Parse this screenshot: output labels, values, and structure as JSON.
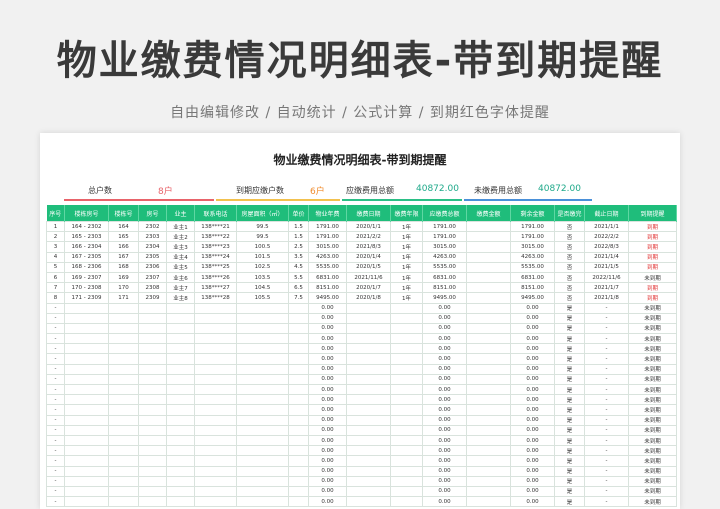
{
  "banner": {
    "title": "物业缴费情况明细表-带到期提醒",
    "subtitle": "自由编辑修改  /  自动统计  /  公式计算  /  到期红色字体提醒"
  },
  "sheet": {
    "title": "物业缴费情况明细表-带到期提醒",
    "stats": {
      "total_households_label": "总户数",
      "total_households_value": "8户",
      "due_households_label": "到期应缴户数",
      "due_households_value": "6户",
      "due_amount_label": "应缴费用总额",
      "due_amount_value": "40872.00",
      "unpaid_amount_label": "未缴费用总额",
      "unpaid_amount_value": "40872.00"
    },
    "colors": {
      "header_green": "#1fbd7b",
      "overdue_red": "#e03030",
      "stat_bar_red": "#e8636a",
      "stat_bar_yellow": "#f2c14e",
      "stat_bar_green": "#2bbf86",
      "stat_bar_blue": "#4a90d9",
      "value_orange": "#f08c2e",
      "value_teal": "#1fa98a"
    },
    "columns": [
      "序号",
      "楼栋房号",
      "楼栋号",
      "房号",
      "业主",
      "联系电话",
      "房屋面积（㎡）",
      "单价",
      "物业年费",
      "缴费日期",
      "缴费年限",
      "应缴费总额",
      "缴费金额",
      "剩余金额",
      "是否缴完",
      "截止日期",
      "到期提醒"
    ],
    "rows": [
      [
        "1",
        "164 - 2302",
        "164",
        "2302",
        "业主1",
        "138****21",
        "99.5",
        "1.5",
        "1791.00",
        "2020/1/1",
        "1年",
        "1791.00",
        "",
        "1791.00",
        "否",
        "2021/1/1",
        "到期"
      ],
      [
        "2",
        "165 - 2303",
        "165",
        "2303",
        "业主2",
        "138****22",
        "99.5",
        "1.5",
        "1791.00",
        "2021/2/2",
        "1年",
        "1791.00",
        "",
        "1791.00",
        "否",
        "2022/2/2",
        "到期"
      ],
      [
        "3",
        "166 - 2304",
        "166",
        "2304",
        "业主3",
        "138****23",
        "100.5",
        "2.5",
        "3015.00",
        "2021/8/3",
        "1年",
        "3015.00",
        "",
        "3015.00",
        "否",
        "2022/8/3",
        "到期"
      ],
      [
        "4",
        "167 - 2305",
        "167",
        "2305",
        "业主4",
        "138****24",
        "101.5",
        "3.5",
        "4263.00",
        "2020/1/4",
        "1年",
        "4263.00",
        "",
        "4263.00",
        "否",
        "2021/1/4",
        "到期"
      ],
      [
        "5",
        "168 - 2306",
        "168",
        "2306",
        "业主5",
        "138****25",
        "102.5",
        "4.5",
        "5535.00",
        "2020/1/5",
        "1年",
        "5535.00",
        "",
        "5535.00",
        "否",
        "2021/1/5",
        "到期"
      ],
      [
        "6",
        "169 - 2307",
        "169",
        "2307",
        "业主6",
        "138****26",
        "103.5",
        "5.5",
        "6831.00",
        "2021/11/6",
        "1年",
        "6831.00",
        "",
        "6831.00",
        "否",
        "2022/11/6",
        "未到期"
      ],
      [
        "7",
        "170 - 2308",
        "170",
        "2308",
        "业主7",
        "138****27",
        "104.5",
        "6.5",
        "8151.00",
        "2020/1/7",
        "1年",
        "8151.00",
        "",
        "8151.00",
        "否",
        "2021/1/7",
        "到期"
      ],
      [
        "8",
        "171 - 2309",
        "171",
        "2309",
        "业主8",
        "138****28",
        "105.5",
        "7.5",
        "9495.00",
        "2020/1/8",
        "1年",
        "9495.00",
        "",
        "9495.00",
        "否",
        "2021/1/8",
        "到期"
      ]
    ],
    "empty_row": [
      "-",
      "",
      "",
      "",
      "",
      "",
      "",
      "",
      "0.00",
      "",
      "",
      "0.00",
      "",
      "0.00",
      "是",
      "-",
      "未到期"
    ],
    "empty_row_count": 20
  }
}
